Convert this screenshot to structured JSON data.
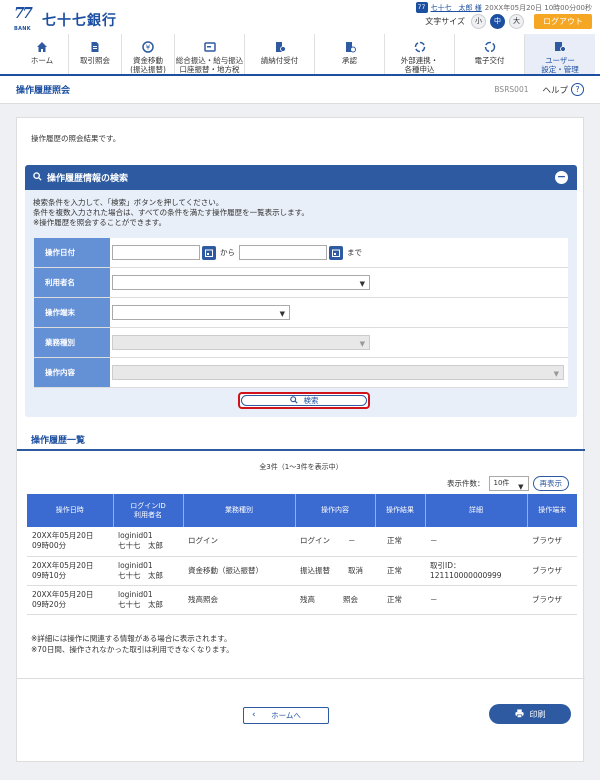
{
  "header": {
    "logo_mark": "77",
    "logo_bank": "BANK",
    "logo_text": "七十七銀行",
    "user_icon": "77",
    "user_name": "七十七　太郎 様",
    "last_login": "20XX年05月20日 10時00分00秒",
    "font_size_label": "文字サイズ",
    "font_small": "小",
    "font_medium": "中",
    "font_large": "大",
    "logout": "ログアウト"
  },
  "nav": [
    {
      "label1": "ホーム",
      "label2": "",
      "icon": "home-icon"
    },
    {
      "label1": "取引照会",
      "label2": "",
      "icon": "document-icon"
    },
    {
      "label1": "資金移動",
      "label2": "(振込振替)",
      "icon": "transfer-icon"
    },
    {
      "label1": "総合振込・給与振込",
      "label2": "口座振替・地方税",
      "icon": "payment-icon"
    },
    {
      "label1": "請納付受付",
      "label2": "",
      "icon": "tax-icon"
    },
    {
      "label1": "承認",
      "label2": "",
      "icon": "approve-icon"
    },
    {
      "label1": "外部連携・",
      "label2": "各種申込",
      "icon": "link-icon"
    },
    {
      "label1": "電子交付",
      "label2": "",
      "icon": "cycle-icon"
    },
    {
      "label1": "ユーザー",
      "label2": "設定・管理",
      "icon": "user-settings-icon"
    }
  ],
  "page": {
    "title": "操作履歴照会",
    "code": "BSRS001",
    "help": "ヘルプ"
  },
  "message": "操作履歴の照会結果です。",
  "search": {
    "title": "操作履歴情報の検索",
    "instr1": "検索条件を入力して、「検索」ボタンを押してください。",
    "instr2": "条件を複数入力された場合は、すべての条件を満たす操作履歴を一覧表示します。",
    "instr3": "※操作履歴を照会することができます。",
    "date_label": "操作日付",
    "from": "から",
    "to": "まで",
    "user_label": "利用者名",
    "terminal_label": "操作端末",
    "business_label": "業務種別",
    "operation_label": "操作内容",
    "button": "検索"
  },
  "list": {
    "title": "操作履歴一覧",
    "count": "全3件（1〜3件を表示中）",
    "pagesize_label": "表示件数：",
    "pagesize_value": "10件",
    "redisplay": "再表示",
    "headers": [
      "操作日時",
      "ログインID",
      "利用者名",
      "業務種別",
      "操作内容",
      "操作結果",
      "詳細",
      "操作端末"
    ],
    "rows": [
      {
        "date": "20XX年05月20日",
        "time": "09時00分",
        "login": "loginid01",
        "user": "七十七　太郎",
        "business": "ログイン",
        "op": "ログイン",
        "op2": "－",
        "result": "正常",
        "detail1": "－",
        "detail2": "",
        "terminal": "ブラウザ"
      },
      {
        "date": "20XX年05月20日",
        "time": "09時10分",
        "login": "loginid01",
        "user": "七十七　太郎",
        "business": "資金移動（振込振替）",
        "op": "振込振替",
        "op2": "取消",
        "result": "正常",
        "detail1": "取引ID：",
        "detail2": "121110000000999",
        "terminal": "ブラウザ"
      },
      {
        "date": "20XX年05月20日",
        "time": "09時20分",
        "login": "loginid01",
        "user": "七十七　太郎",
        "business": "残高照会",
        "op": "残高",
        "op2": "照会",
        "result": "正常",
        "detail1": "－",
        "detail2": "",
        "terminal": "ブラウザ"
      }
    ],
    "note1": "※詳細には操作に関連する情報がある場合に表示されます。",
    "note2": "※70日間、操作されなかった取引は利用できなくなります。"
  },
  "footer": {
    "home": "ホームへ",
    "print": "印刷"
  }
}
